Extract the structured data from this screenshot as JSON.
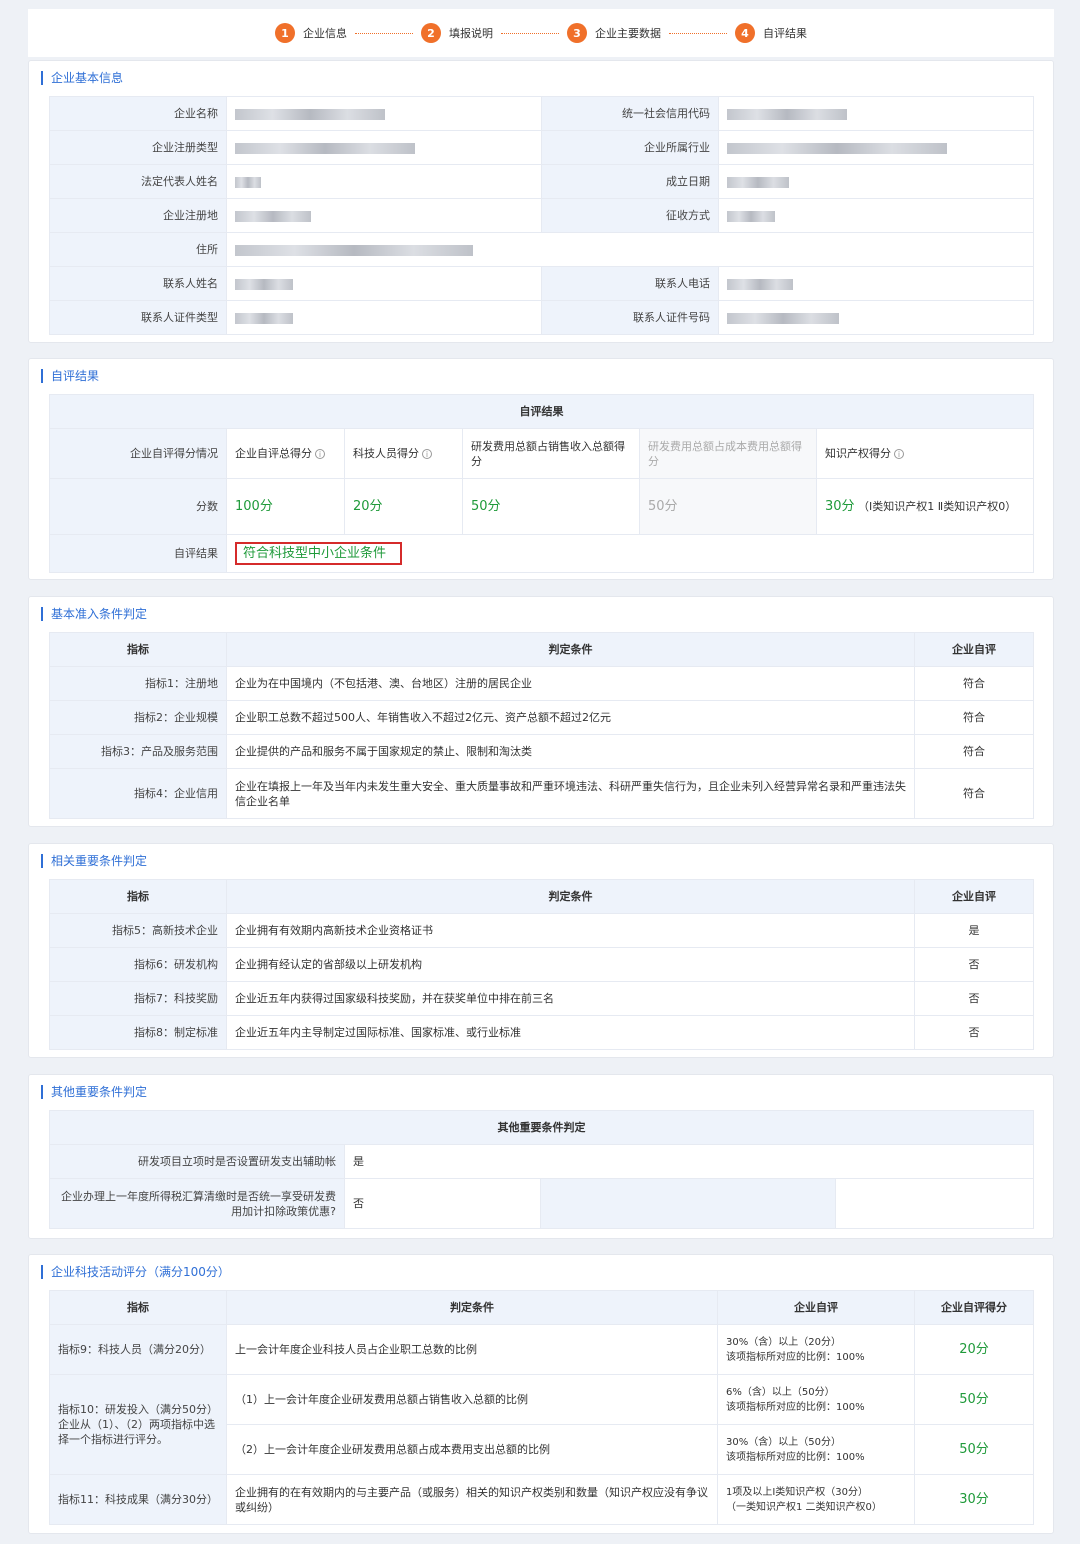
{
  "steps": [
    {
      "num": "1",
      "label": "企业信息"
    },
    {
      "num": "2",
      "label": "填报说明"
    },
    {
      "num": "3",
      "label": "企业主要数据"
    },
    {
      "num": "4",
      "label": "自评结果"
    }
  ],
  "basic_info": {
    "title": "企业基本信息",
    "labels": {
      "name": "企业名称",
      "credit_code": "统一社会信用代码",
      "reg_type": "企业注册类型",
      "industry": "企业所属行业",
      "legal_rep": "法定代表人姓名",
      "found_date": "成立日期",
      "reg_place": "企业注册地",
      "collect_method": "征收方式",
      "address": "住所",
      "contact_name": "联系人姓名",
      "contact_phone": "联系人电话",
      "id_type": "联系人证件类型",
      "id_number": "联系人证件号码"
    }
  },
  "self_eval": {
    "title": "自评结果",
    "header": "自评结果",
    "row_label": "企业自评得分情况",
    "columns": [
      "企业自评总得分",
      "科技人员得分",
      "研发费用总额占销售收入总额得分",
      "研发费用总额占成本费用总额得分",
      "知识产权得分"
    ],
    "score_label": "分数",
    "scores": [
      "100分",
      "20分",
      "50分",
      "50分",
      "30分"
    ],
    "ip_detail": "（Ⅰ类知识产权1 Ⅱ类知识产权0）",
    "result_label": "自评结果",
    "result_value": "符合科技型中小企业条件"
  },
  "basic_conditions": {
    "title": "基本准入条件判定",
    "headers": [
      "指标",
      "判定条件",
      "企业自评"
    ],
    "rows": [
      {
        "indicator": "指标1：注册地",
        "condition": "企业为在中国境内（不包括港、澳、台地区）注册的居民企业",
        "eval": "符合"
      },
      {
        "indicator": "指标2：企业规模",
        "condition": "企业职工总数不超过500人、年销售收入不超过2亿元、资产总额不超过2亿元",
        "eval": "符合"
      },
      {
        "indicator": "指标3：产品及服务范围",
        "condition": "企业提供的产品和服务不属于国家规定的禁止、限制和淘汰类",
        "eval": "符合"
      },
      {
        "indicator": "指标4：企业信用",
        "condition": "企业在填报上一年及当年内未发生重大安全、重大质量事故和严重环境违法、科研严重失信行为，且企业未列入经营异常名录和严重违法失信企业名单",
        "eval": "符合"
      }
    ]
  },
  "important_conditions": {
    "title": "相关重要条件判定",
    "headers": [
      "指标",
      "判定条件",
      "企业自评"
    ],
    "rows": [
      {
        "indicator": "指标5：高新技术企业",
        "condition": "企业拥有有效期内高新技术企业资格证书",
        "eval": "是"
      },
      {
        "indicator": "指标6：研发机构",
        "condition": "企业拥有经认定的省部级以上研发机构",
        "eval": "否"
      },
      {
        "indicator": "指标7：科技奖励",
        "condition": "企业近五年内获得过国家级科技奖励，并在获奖单位中排在前三名",
        "eval": "否"
      },
      {
        "indicator": "指标8：制定标准",
        "condition": "企业近五年内主导制定过国际标准、国家标准、或行业标准",
        "eval": "否"
      }
    ]
  },
  "other_conditions": {
    "title": "其他重要条件判定",
    "header": "其他重要条件判定",
    "rows": [
      {
        "label": "研发项目立项时是否设置研发支出辅助帐",
        "value": "是"
      },
      {
        "label": "企业办理上一年度所得税汇算清缴时是否统一享受研发费用加计扣除政策优惠?",
        "value": "否"
      }
    ]
  },
  "tech_activity": {
    "title": "企业科技活动评分（满分100分）",
    "headers": [
      "指标",
      "判定条件",
      "企业自评",
      "企业自评得分"
    ],
    "rows": [
      {
        "indicator": "指标9：科技人员（满分20分）",
        "condition": "上一会计年度企业科技人员占企业职工总数的比例",
        "eval_line1": "30%（含）以上（20分）",
        "eval_line2": "该项指标所对应的比例：100%",
        "score": "20分"
      },
      {
        "indicator": "指标10：研发投入（满分50分）",
        "indicator_note": "企业从（1）、（2）两项指标中选择一个指标进行评分。",
        "condition": "（1）上一会计年度企业研发费用总额占销售收入总额的比例",
        "eval_line1": "6%（含）以上（50分）",
        "eval_line2": "该项指标所对应的比例：100%",
        "score": "50分"
      },
      {
        "condition": "（2）上一会计年度企业研发费用总额占成本费用支出总额的比例",
        "eval_line1": "30%（含）以上（50分）",
        "eval_line2": "该项指标所对应的比例：100%",
        "score": "50分"
      },
      {
        "indicator": "指标11：科技成果（满分30分）",
        "condition": "企业拥有的在有效期内的与主要产品（或服务）相关的知识产权类别和数量（知识产权应没有争议或纠纷）",
        "eval_line1": "1项及以上Ⅰ类知识产权（30分）",
        "eval_line2": "（一类知识产权1 二类知识产权0）",
        "score": "30分"
      }
    ]
  },
  "colors": {
    "accent": "#2f6fd6",
    "step": "#f0702a",
    "pass": "#1f9a3a",
    "highlight_border": "#d52b2b",
    "label_bg": "#eef3fb"
  }
}
